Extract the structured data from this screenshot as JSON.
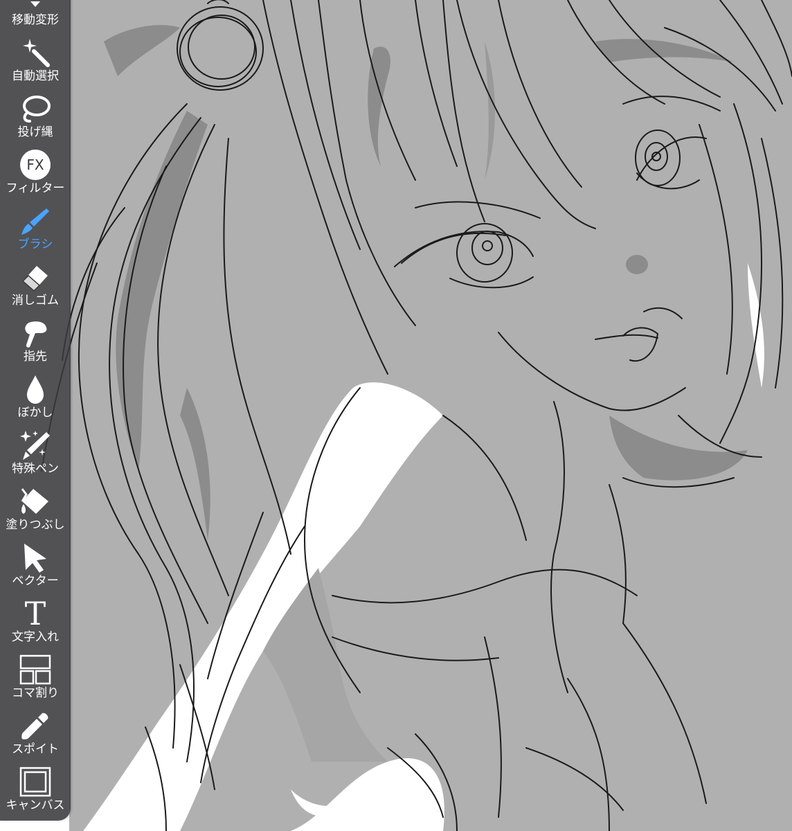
{
  "toolbar": {
    "tools": [
      {
        "label": "移動変形",
        "icon": "move-transform-icon",
        "active": false
      },
      {
        "label": "自動選択",
        "icon": "magic-wand-icon",
        "active": false
      },
      {
        "label": "投げ縄",
        "icon": "lasso-icon",
        "active": false
      },
      {
        "label": "フィルター",
        "icon": "fx-filter-icon",
        "icon_text": "FX",
        "active": false
      },
      {
        "label": "ブラシ",
        "icon": "brush-icon",
        "active": true
      },
      {
        "label": "消しゴム",
        "icon": "eraser-icon",
        "active": false
      },
      {
        "label": "指先",
        "icon": "finger-smudge-icon",
        "active": false
      },
      {
        "label": "ぼかし",
        "icon": "blur-drop-icon",
        "active": false
      },
      {
        "label": "特殊ペン",
        "icon": "special-pen-icon",
        "active": false
      },
      {
        "label": "塗りつぶし",
        "icon": "fill-bucket-icon",
        "active": false
      },
      {
        "label": "ベクター",
        "icon": "vector-arrow-icon",
        "active": false
      },
      {
        "label": "文字入れ",
        "icon": "text-icon",
        "icon_text": "T",
        "active": false
      },
      {
        "label": "コマ割り",
        "icon": "frame-divider-icon",
        "active": false
      },
      {
        "label": "スポイト",
        "icon": "eyedropper-icon",
        "active": false
      },
      {
        "label": "キャンバス",
        "icon": "canvas-icon",
        "active": false
      }
    ]
  },
  "colors": {
    "toolbar_bg": "#3a3a3c",
    "label_default": "#ffffff",
    "label_active": "#4aa3ff",
    "canvas_gray": "#b0b0b0",
    "canvas_dark": "#8a8a8a",
    "line": "#1a1a1a"
  }
}
